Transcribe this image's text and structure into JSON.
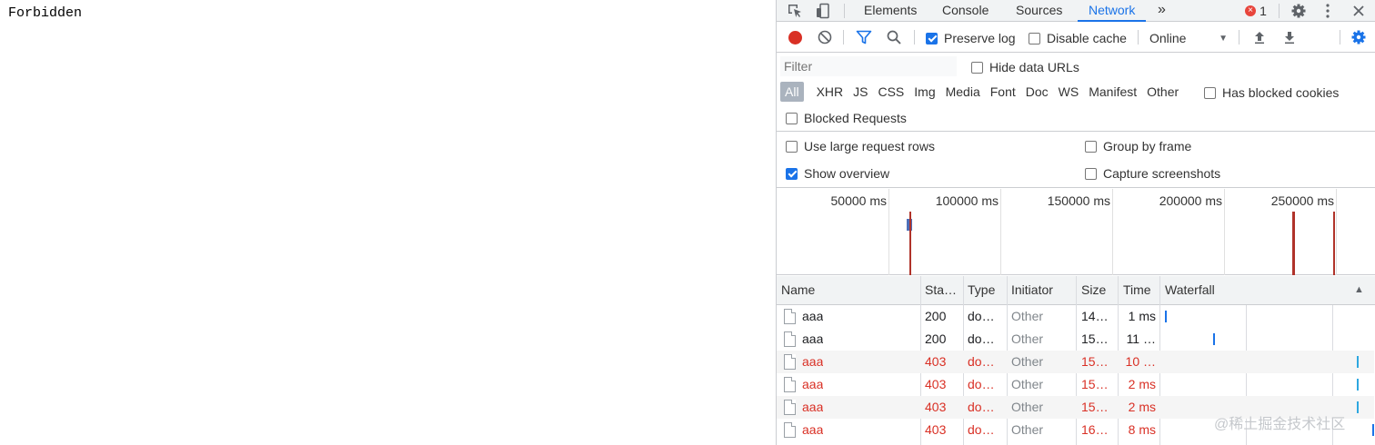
{
  "page": {
    "body_text": "Forbidden"
  },
  "devtools": {
    "tabs": [
      "Elements",
      "Console",
      "Sources",
      "Network"
    ],
    "active_tab": "Network",
    "more_tabs_glyph": "»",
    "error_count": "1",
    "icons": {
      "inspect": "element-picker-icon",
      "device": "device-toolbar-icon",
      "settings": "gear-icon",
      "menu": "kebab-menu-icon",
      "close": "close-icon"
    }
  },
  "toolbar": {
    "preserve_log_label": "Preserve log",
    "preserve_log_checked": true,
    "disable_cache_label": "Disable cache",
    "disable_cache_checked": false,
    "throttling_value": "Online"
  },
  "filter": {
    "placeholder": "Filter",
    "hide_data_urls_label": "Hide data URLs",
    "types": [
      "All",
      "XHR",
      "JS",
      "CSS",
      "Img",
      "Media",
      "Font",
      "Doc",
      "WS",
      "Manifest",
      "Other"
    ],
    "active_type": "All",
    "has_blocked_cookies_label": "Has blocked cookies",
    "blocked_requests_label": "Blocked Requests"
  },
  "settings": {
    "large_rows_label": "Use large request rows",
    "group_by_frame_label": "Group by frame",
    "show_overview_label": "Show overview",
    "capture_screenshots_label": "Capture screenshots"
  },
  "overview": {
    "tick_labels": [
      "50000 ms",
      "100000 ms",
      "150000 ms",
      "200000 ms",
      "250000 ms"
    ]
  },
  "table": {
    "headers": {
      "name": "Name",
      "status": "Sta…",
      "type": "Type",
      "initiator": "Initiator",
      "size": "Size",
      "time": "Time",
      "waterfall": "Waterfall"
    },
    "sort_glyph": "▲",
    "rows": [
      {
        "name": "aaa",
        "status": "200",
        "type": "do…",
        "initiator": "Other",
        "size": "14…",
        "time": "1 ms",
        "error": false
      },
      {
        "name": "aaa",
        "status": "200",
        "type": "do…",
        "initiator": "Other",
        "size": "15…",
        "time": "11 …",
        "error": false
      },
      {
        "name": "aaa",
        "status": "403",
        "type": "do…",
        "initiator": "Other",
        "size": "15…",
        "time": "10 …",
        "error": true
      },
      {
        "name": "aaa",
        "status": "403",
        "type": "do…",
        "initiator": "Other",
        "size": "15…",
        "time": "2 ms",
        "error": true
      },
      {
        "name": "aaa",
        "status": "403",
        "type": "do…",
        "initiator": "Other",
        "size": "15…",
        "time": "2 ms",
        "error": true
      },
      {
        "name": "aaa",
        "status": "403",
        "type": "do…",
        "initiator": "Other",
        "size": "16…",
        "time": "8 ms",
        "error": true
      }
    ]
  },
  "watermark": "@稀土掘金技术社区",
  "colors": {
    "accent": "#1a73e8",
    "record": "#d93025",
    "error_text": "#d93025",
    "error_badge": "#e8453c"
  }
}
